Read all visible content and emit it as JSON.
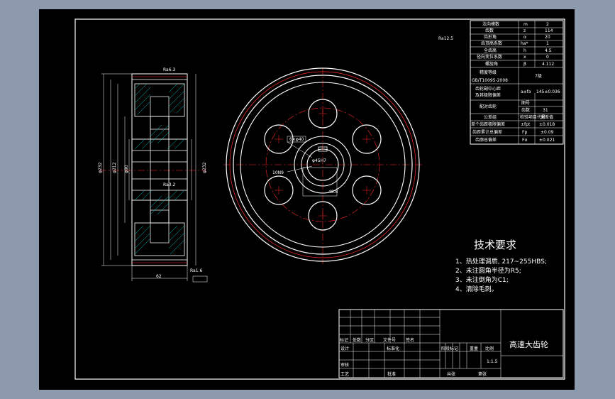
{
  "drawing": {
    "title": "高速大齿轮",
    "notes": {
      "heading": "技术要求",
      "items": [
        "1、热处理调质, 217~255HBS;",
        "2、未注圆角半径为R5;",
        "3、未注倒角为C1;",
        "4、清除毛刺。"
      ]
    },
    "params": [
      {
        "name": "法向模数",
        "sym": "m",
        "val": "2"
      },
      {
        "name": "齿数",
        "sym": "z",
        "val": "114"
      },
      {
        "name": "齿形角",
        "sym": "α",
        "val": "20"
      },
      {
        "name": "齿顶高系数",
        "sym": "ha*",
        "val": "1"
      },
      {
        "name": "全齿高",
        "sym": "h",
        "val": "4.5"
      },
      {
        "name": "径向变位系数",
        "sym": "x",
        "val": "0"
      },
      {
        "name": "螺旋角",
        "sym": "β",
        "val": "4.112"
      }
    ],
    "accuracy_label": "精度等级",
    "accuracy_std": "GB/T10095-2008",
    "accuracy_val": "7级",
    "center_label1": "齿轮副中心距",
    "center_label2": "及其极限偏差",
    "center_val": "a±fa",
    "center_dev": "145±0.036",
    "mate_label": "配对齿轮",
    "mate_row1": "图号",
    "mate_row2": "齿数",
    "mate_row2_val": "31",
    "group_label": "公差组",
    "group_col2": "检验项目代号",
    "group_col3": "偏差值",
    "tol_rows": [
      {
        "name": "单个齿距极限偏差",
        "sym": "±fpt",
        "val": "±0.018"
      },
      {
        "name": "齿距累计总偏差",
        "sym": "Fp",
        "val": "±0.09"
      },
      {
        "name": "齿廓总偏差",
        "sym": "Fα",
        "val": "±0.021"
      }
    ],
    "titleblock": {
      "r1": [
        "标记",
        "处数",
        "分区",
        "文件号",
        "签名"
      ],
      "design": "设计",
      "standard": "标准化",
      "stage": "阶段标记",
      "weight": "重量",
      "scale": "比例",
      "scale_val": "1:1.5",
      "review": "审核",
      "process": "工艺",
      "approve": "批准",
      "sheets": "共张",
      "sheet": "第张"
    },
    "roughness_note": "Ra6.3",
    "keyway_label": "10N9",
    "bore_label": "φ45H7",
    "hole_label": "6×φ40"
  }
}
